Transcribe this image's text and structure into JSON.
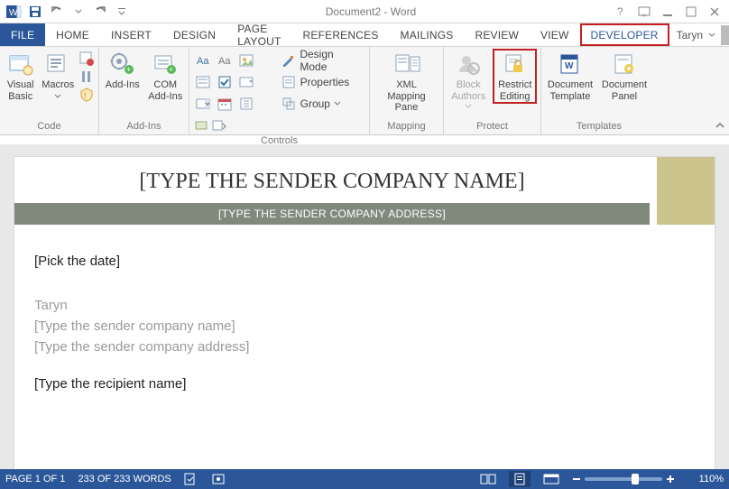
{
  "titlebar": {
    "title": "Document2 - Word"
  },
  "tabs": {
    "file": "FILE",
    "items": [
      "HOME",
      "INSERT",
      "DESIGN",
      "PAGE LAYOUT",
      "REFERENCES",
      "MAILINGS",
      "REVIEW",
      "VIEW",
      "DEVELOPER"
    ]
  },
  "account": {
    "name": "Taryn"
  },
  "ribbon": {
    "code": {
      "visual_basic": "Visual Basic",
      "macros": "Macros",
      "label": "Code"
    },
    "addins": {
      "addins": "Add-Ins",
      "com": "COM Add-Ins",
      "label": "Add-Ins"
    },
    "controls": {
      "design_mode": "Design Mode",
      "properties": "Properties",
      "group": "Group",
      "label": "Controls"
    },
    "mapping": {
      "xml_pane": "XML Mapping Pane",
      "label": "Mapping"
    },
    "protect": {
      "block_authors": "Block Authors",
      "restrict_editing": "Restrict Editing",
      "label": "Protect"
    },
    "templates": {
      "doc_template": "Document Template",
      "doc_panel": "Document Panel",
      "label": "Templates"
    }
  },
  "doc": {
    "sender_company_title": "[TYPE THE SENDER COMPANY NAME]",
    "sender_company_addr": "[TYPE THE SENDER COMPANY ADDRESS]",
    "pick_date": "[Pick the date]",
    "sender_name": "Taryn",
    "sender_company_line": "[Type the sender company name]",
    "sender_company_addr_line": "[Type the sender company address]",
    "recipient_name": "[Type the recipient name]"
  },
  "status": {
    "page": "PAGE 1 OF 1",
    "words": "233 OF 233 WORDS",
    "zoom": "110%"
  }
}
